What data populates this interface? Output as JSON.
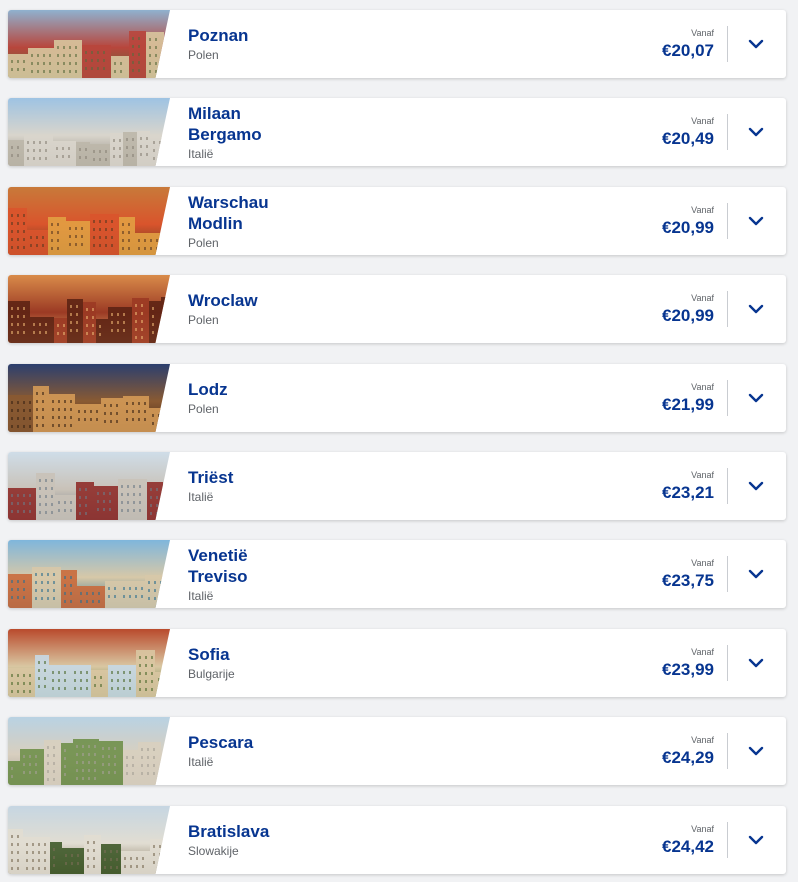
{
  "accent_color": "#073590",
  "destinations": [
    {
      "name_lines": [
        "Poznan"
      ],
      "country": "Polen",
      "from_label": "Vanaf",
      "price": "€20,07",
      "palette": [
        "#8fb1cf",
        "#b8463c",
        "#d8c79e",
        "#5a6b3e"
      ]
    },
    {
      "name_lines": [
        "Milaan",
        "Bergamo"
      ],
      "country": "Italië",
      "from_label": "Vanaf",
      "price": "€20,49",
      "palette": [
        "#9ec3e3",
        "#d9d5cc",
        "#bdb7aa",
        "#8a8478"
      ]
    },
    {
      "name_lines": [
        "Warschau",
        "Modlin"
      ],
      "country": "Polen",
      "from_label": "Vanaf",
      "price": "€20,99",
      "palette": [
        "#c87a3a",
        "#d9542c",
        "#e2a042",
        "#5c3b22"
      ]
    },
    {
      "name_lines": [
        "Wroclaw"
      ],
      "country": "Polen",
      "from_label": "Vanaf",
      "price": "€20,99",
      "palette": [
        "#d98b4a",
        "#9b3a24",
        "#5d2414",
        "#e8b070"
      ]
    },
    {
      "name_lines": [
        "Lodz"
      ],
      "country": "Polen",
      "from_label": "Vanaf",
      "price": "€21,99",
      "palette": [
        "#2c3f6e",
        "#8a5a32",
        "#d49a56",
        "#3b2416"
      ]
    },
    {
      "name_lines": [
        "Triëst"
      ],
      "country": "Italië",
      "from_label": "Vanaf",
      "price": "€23,21",
      "palette": [
        "#cfdde8",
        "#c9c2b8",
        "#8f2d2a",
        "#6d7a86"
      ]
    },
    {
      "name_lines": [
        "Venetië",
        "Treviso"
      ],
      "country": "Italië",
      "from_label": "Vanaf",
      "price": "€23,75",
      "palette": [
        "#7fb6dc",
        "#d7c8a8",
        "#c96a3c",
        "#2f6f8f"
      ]
    },
    {
      "name_lines": [
        "Sofia"
      ],
      "country": "Bulgarije",
      "from_label": "Vanaf",
      "price": "€23,99",
      "palette": [
        "#b94a2c",
        "#d9c7a2",
        "#c7d8e4",
        "#4e6b2e"
      ]
    },
    {
      "name_lines": [
        "Pescara"
      ],
      "country": "Italië",
      "from_label": "Vanaf",
      "price": "€24,29",
      "palette": [
        "#b9d2e3",
        "#d8cfbf",
        "#6f8f4a",
        "#a5a096"
      ]
    },
    {
      "name_lines": [
        "Bratislava"
      ],
      "country": "Slowakije",
      "from_label": "Vanaf",
      "price": "€24,42",
      "palette": [
        "#c6d6e2",
        "#e1ddd2",
        "#3f5a2a",
        "#7a6d55"
      ]
    }
  ]
}
